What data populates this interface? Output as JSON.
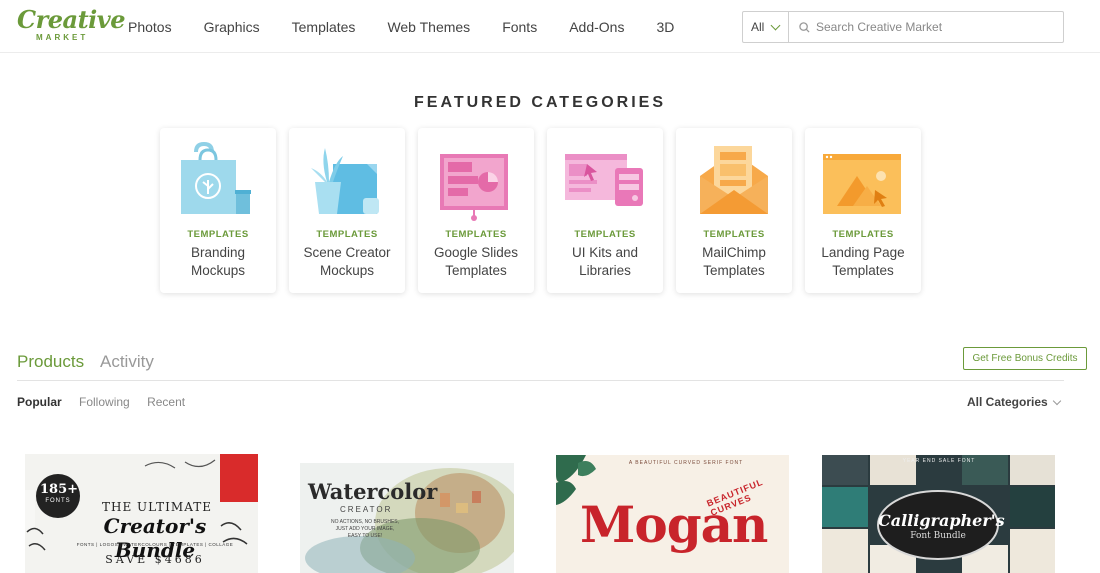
{
  "logo": {
    "word": "Creative",
    "sub": "MARKET"
  },
  "nav": [
    "Photos",
    "Graphics",
    "Templates",
    "Web Themes",
    "Fonts",
    "Add-Ons",
    "3D"
  ],
  "search": {
    "scope": "All",
    "placeholder": "Search Creative Market"
  },
  "featured": {
    "title": "FEATURED CATEGORIES",
    "cards": [
      {
        "kind": "TEMPLATES",
        "name": "Branding Mockups",
        "icon": "shopping-bag-icon"
      },
      {
        "kind": "TEMPLATES",
        "name": "Scene Creator Mockups",
        "icon": "plant-scene-icon"
      },
      {
        "kind": "TEMPLATES",
        "name": "Google Slides Templates",
        "icon": "presentation-icon"
      },
      {
        "kind": "TEMPLATES",
        "name": "UI Kits and Libraries",
        "icon": "ui-kit-icon"
      },
      {
        "kind": "TEMPLATES",
        "name": "MailChimp Templates",
        "icon": "envelope-icon"
      },
      {
        "kind": "TEMPLATES",
        "name": "Landing Page Templates",
        "icon": "landing-page-icon"
      }
    ]
  },
  "tabs": {
    "products": "Products",
    "activity": "Activity"
  },
  "bonus_button": "Get Free Bonus Credits",
  "subtabs": {
    "popular": "Popular",
    "following": "Following",
    "recent": "Recent"
  },
  "all_categories": "All Categories",
  "products": [
    {
      "badge": "185+",
      "badge_sub": "FONTS",
      "line1": "THE ULTIMATE",
      "line2": "Creator's Bundle",
      "line3": "FONTS | LOGOS | WATERCOLOURS | TEMPLATES | COLLAGE",
      "price": "SAVE $4686"
    },
    {
      "title": "Watercolor",
      "sub": "CREATOR",
      "note1": "NO ACTIONS, NO BRUSHES,",
      "note2": "JUST ADD YOUR IMAGE,",
      "note3": "EASY TO USE!"
    },
    {
      "top": "A BEAUTIFUL CURVED SERIF FONT",
      "title": "Mogan",
      "curve": "BEAUTIFUL CURVES"
    },
    {
      "top": "YEAR END SALE FONT",
      "title": "Calligrapher's",
      "sub": "Font Bundle"
    }
  ]
}
